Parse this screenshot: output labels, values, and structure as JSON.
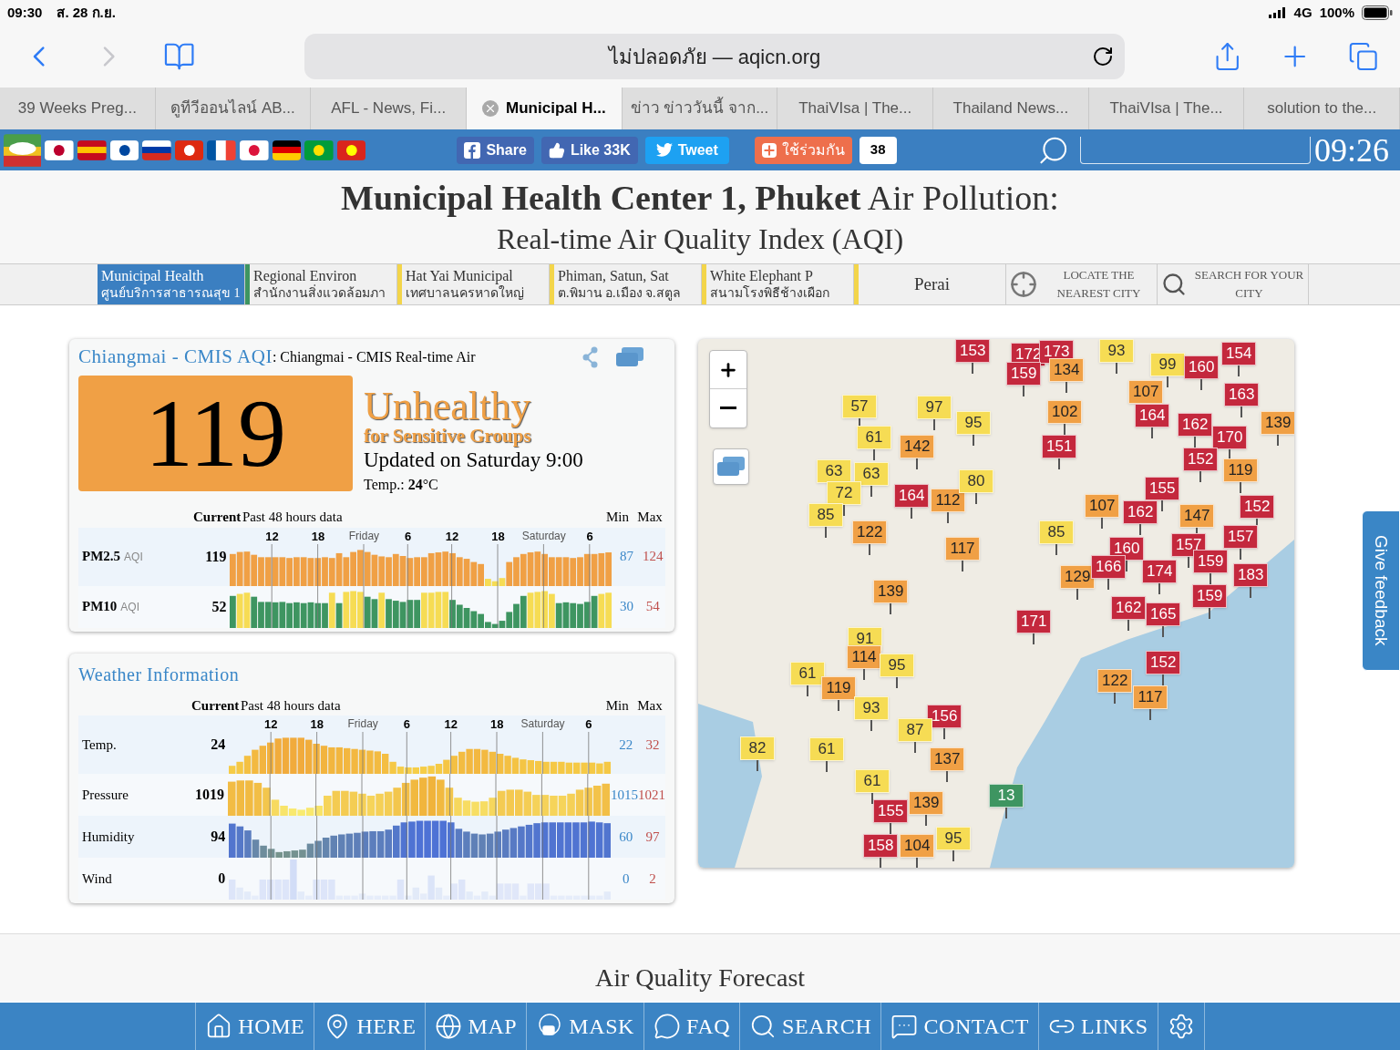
{
  "status_bar": {
    "time": "09:30",
    "date": "ส. 28 ก.ย.",
    "network": "4G",
    "battery": "100%"
  },
  "browser": {
    "address": "ไม่ปลอดภัย — aqicn.org"
  },
  "browser_tabs": [
    {
      "title": "39 Weeks Preg...",
      "selected": false
    },
    {
      "title": "ดูทีวีออนไลน์ AB...",
      "selected": false
    },
    {
      "title": "AFL - News, Fi...",
      "selected": false
    },
    {
      "title": "Municipal H...",
      "selected": true
    },
    {
      "title": "ข่าว ข่าววันนี้ จาก...",
      "selected": false
    },
    {
      "title": "ThaiVIsa | The...",
      "selected": false
    },
    {
      "title": "Thailand News...",
      "selected": false
    },
    {
      "title": "ThaiVIsa | The...",
      "selected": false
    },
    {
      "title": "solution to the...",
      "selected": false
    }
  ],
  "social_bar": {
    "share": "Share",
    "like": "Like 33K",
    "tweet": "Tweet",
    "thai_share": "ใช้ร่วมกัน",
    "share_count": "38",
    "clock": "09:26"
  },
  "page_title": {
    "title": "**Municipal Health Center 1, Phuket** Air Pollution:",
    "subtitle": "Real-time Air Quality Index (AQI)"
  },
  "stations": [
    {
      "name": "Municipal Health",
      "thai": "ศูนย์บริการสาธารณสุข 1",
      "selected": true
    },
    {
      "name": "Regional Environ",
      "thai": "สำนักงานสิ่งแวดล้อมภา",
      "color": "#3e9561",
      "selected": false
    },
    {
      "name": "Hat Yai Municipal",
      "thai": "เทศบาลนครหาดใหญ่",
      "color": "#f3d54a",
      "selected": false
    },
    {
      "name": "Phiman, Satun, Sat",
      "thai": "ต.พิมาน อ.เมือง จ.สตูล",
      "color": "#f3d54a",
      "selected": false
    },
    {
      "name": "White Elephant P",
      "thai": "สนามโรงพิธีช้างเผือก",
      "color": "#f3d54a",
      "selected": false
    },
    {
      "name": "Perai",
      "color": "#f3d54a",
      "selected": false
    }
  ],
  "station_tools": [
    {
      "kind": "locate",
      "label": "LOCATE THE NEAREST CITY"
    },
    {
      "kind": "search",
      "label": "SEARCH FOR YOUR CITY"
    }
  ],
  "aqi_card": {
    "title": "Chiangmai - CMIS AQI",
    "subtitle": ": Chiangmai - CMIS Real-time Air",
    "value": "119",
    "color": "#f0a045",
    "status": "Unhealthy",
    "status_sub": "for Sensitive Groups",
    "updated": "Updated on Saturday 9:00",
    "temp": "Temp.: **24**°C",
    "header": {
      "current": "Current",
      "past": "Past 48 hours data",
      "min": "Min",
      "max": "Max"
    },
    "ticks": [
      {
        "label": "12",
        "kind": "hour"
      },
      {
        "label": "18",
        "kind": "hour"
      },
      {
        "label": "Friday",
        "kind": "day"
      },
      {
        "label": "6",
        "kind": "hour"
      },
      {
        "label": "12",
        "kind": "hour"
      },
      {
        "label": "18",
        "kind": "hour"
      },
      {
        "label": "Saturday",
        "kind": "day"
      },
      {
        "label": "6",
        "kind": "hour"
      }
    ],
    "rows": [
      {
        "name": "PM2.5",
        "unit": "AQI",
        "current": "119",
        "min": "87",
        "max": "124",
        "kind": "pm25"
      },
      {
        "name": "PM10",
        "unit": "AQI",
        "current": "52",
        "min": "30",
        "max": "54",
        "kind": "pm10"
      }
    ]
  },
  "weather_card": {
    "title": "Weather Information",
    "header": {
      "current": "Current",
      "past": "Past 48 hours data",
      "min": "Min",
      "max": "Max"
    },
    "ticks": [
      {
        "label": "12",
        "kind": "hour"
      },
      {
        "label": "18",
        "kind": "hour"
      },
      {
        "label": "Friday",
        "kind": "day"
      },
      {
        "label": "6",
        "kind": "hour"
      },
      {
        "label": "12",
        "kind": "hour"
      },
      {
        "label": "18",
        "kind": "hour"
      },
      {
        "label": "Saturday",
        "kind": "day"
      },
      {
        "label": "6",
        "kind": "hour"
      }
    ],
    "rows": [
      {
        "name": "Temp.",
        "current": "24",
        "min": "22",
        "max": "32",
        "kind": "temp"
      },
      {
        "name": "Pressure",
        "current": "1019",
        "min": "1015",
        "max": "1021",
        "kind": "pressure"
      },
      {
        "name": "Humidity",
        "current": "94",
        "min": "60",
        "max": "97",
        "kind": "humidity"
      },
      {
        "name": "Wind",
        "current": "0",
        "min": "0",
        "max": "2",
        "kind": "wind"
      }
    ]
  },
  "map": {
    "markers": [
      {
        "value": "153",
        "kind": "unhealthy"
      },
      {
        "value": "172",
        "kind": "unhealthy"
      },
      {
        "value": "173",
        "kind": "unhealthy"
      },
      {
        "value": "93",
        "kind": "moderate"
      },
      {
        "value": "154",
        "kind": "unhealthy"
      },
      {
        "value": "159",
        "kind": "unhealthy"
      },
      {
        "value": "134",
        "kind": "usg"
      },
      {
        "value": "99",
        "kind": "moderate"
      },
      {
        "value": "160",
        "kind": "unhealthy"
      },
      {
        "value": "107",
        "kind": "usg"
      },
      {
        "value": "163",
        "kind": "unhealthy"
      },
      {
        "value": "57",
        "kind": "moderate"
      },
      {
        "value": "97",
        "kind": "moderate"
      },
      {
        "value": "95",
        "kind": "moderate"
      },
      {
        "value": "102",
        "kind": "usg"
      },
      {
        "value": "164",
        "kind": "unhealthy"
      },
      {
        "value": "162",
        "kind": "unhealthy"
      },
      {
        "value": "139",
        "kind": "usg"
      },
      {
        "value": "61",
        "kind": "moderate"
      },
      {
        "value": "142",
        "kind": "usg"
      },
      {
        "value": "151",
        "kind": "unhealthy"
      },
      {
        "value": "170",
        "kind": "unhealthy"
      },
      {
        "value": "63",
        "kind": "moderate"
      },
      {
        "value": "63",
        "kind": "moderate"
      },
      {
        "value": "152",
        "kind": "unhealthy"
      },
      {
        "value": "119",
        "kind": "usg"
      },
      {
        "value": "72",
        "kind": "moderate"
      },
      {
        "value": "164",
        "kind": "unhealthy"
      },
      {
        "value": "112",
        "kind": "usg"
      },
      {
        "value": "80",
        "kind": "moderate"
      },
      {
        "value": "155",
        "kind": "unhealthy"
      },
      {
        "value": "85",
        "kind": "moderate"
      },
      {
        "value": "107",
        "kind": "usg"
      },
      {
        "value": "162",
        "kind": "unhealthy"
      },
      {
        "value": "147",
        "kind": "usg"
      },
      {
        "value": "152",
        "kind": "unhealthy"
      },
      {
        "value": "122",
        "kind": "usg"
      },
      {
        "value": "117",
        "kind": "usg"
      },
      {
        "value": "85",
        "kind": "moderate"
      },
      {
        "value": "160",
        "kind": "unhealthy"
      },
      {
        "value": "157",
        "kind": "unhealthy"
      },
      {
        "value": "157",
        "kind": "unhealthy"
      },
      {
        "value": "129",
        "kind": "usg"
      },
      {
        "value": "166",
        "kind": "unhealthy"
      },
      {
        "value": "174",
        "kind": "unhealthy"
      },
      {
        "value": "159",
        "kind": "unhealthy"
      },
      {
        "value": "183",
        "kind": "unhealthy"
      },
      {
        "value": "139",
        "kind": "usg"
      },
      {
        "value": "159",
        "kind": "unhealthy"
      },
      {
        "value": "171",
        "kind": "unhealthy"
      },
      {
        "value": "162",
        "kind": "unhealthy"
      },
      {
        "value": "165",
        "kind": "unhealthy"
      },
      {
        "value": "91",
        "kind": "moderate"
      },
      {
        "value": "114",
        "kind": "usg"
      },
      {
        "value": "95",
        "kind": "moderate"
      },
      {
        "value": "152",
        "kind": "unhealthy"
      },
      {
        "value": "61",
        "kind": "moderate"
      },
      {
        "value": "122",
        "kind": "usg"
      },
      {
        "value": "119",
        "kind": "usg"
      },
      {
        "value": "117",
        "kind": "usg"
      },
      {
        "value": "93",
        "kind": "moderate"
      },
      {
        "value": "156",
        "kind": "unhealthy"
      },
      {
        "value": "87",
        "kind": "moderate"
      },
      {
        "value": "82",
        "kind": "moderate"
      },
      {
        "value": "61",
        "kind": "moderate"
      },
      {
        "value": "137",
        "kind": "usg"
      },
      {
        "value": "61",
        "kind": "moderate"
      },
      {
        "value": "155",
        "kind": "unhealthy"
      },
      {
        "value": "139",
        "kind": "usg"
      },
      {
        "value": "13",
        "kind": "good"
      },
      {
        "value": "158",
        "kind": "unhealthy"
      },
      {
        "value": "104",
        "kind": "usg"
      },
      {
        "value": "95",
        "kind": "moderate"
      }
    ]
  },
  "feedback": "Give feedback",
  "forecast_title": "Air Quality Forecast",
  "bottom_nav": [
    {
      "label": "HOME",
      "kind": "home"
    },
    {
      "label": "HERE",
      "kind": "here"
    },
    {
      "label": "MAP",
      "kind": "map"
    },
    {
      "label": "MASK",
      "kind": "mask"
    },
    {
      "label": "FAQ",
      "kind": "faq"
    },
    {
      "label": "SEARCH",
      "kind": "search"
    },
    {
      "label": "CONTACT",
      "kind": "contact"
    },
    {
      "label": "LINKS",
      "kind": "links"
    },
    {
      "kind": "settings"
    }
  ]
}
